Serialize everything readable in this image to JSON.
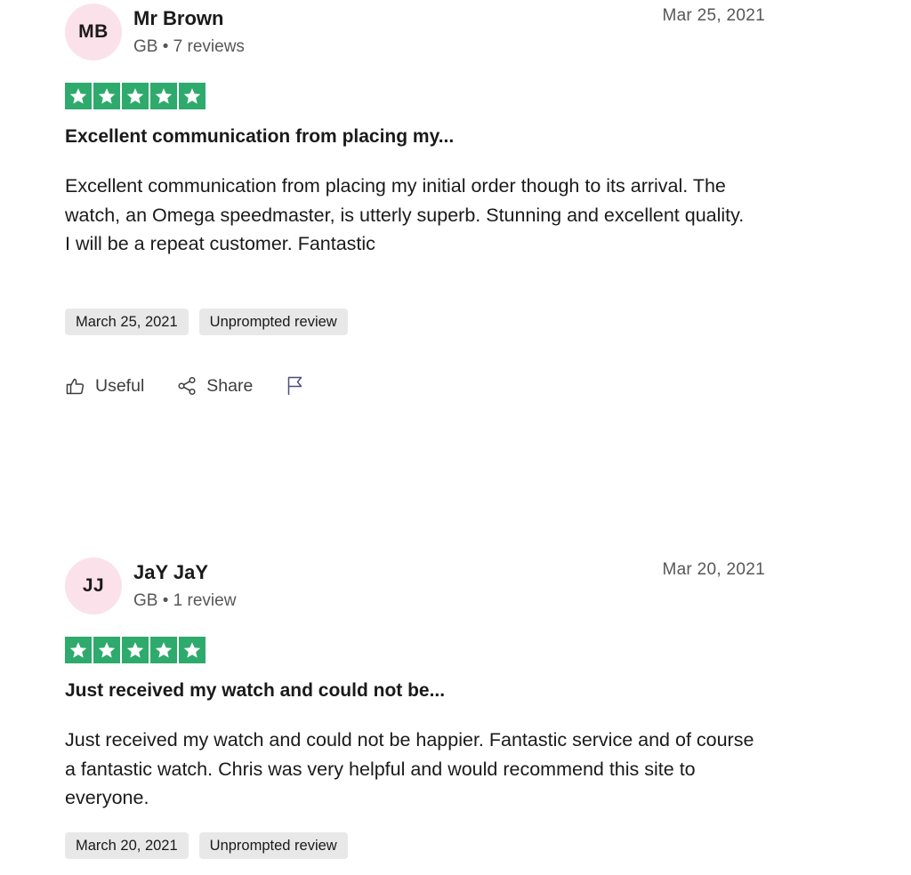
{
  "reviews": [
    {
      "avatar_initials": "MB",
      "name": "Mr Brown",
      "meta": "GB • 7 reviews",
      "date": "Mar 25, 2021",
      "rating": 5,
      "title": "Excellent communication from placing my...",
      "body": "Excellent communication from placing my initial order though to its arrival. The watch, an Omega speedmaster, is utterly superb. Stunning and excellent quality.\nI will be a repeat customer. Fantastic",
      "tags": [
        "March 25, 2021",
        "Unprompted review"
      ],
      "actions": {
        "useful": "Useful",
        "share": "Share"
      }
    },
    {
      "avatar_initials": "JJ",
      "name": "JaY JaY",
      "meta": "GB • 1 review",
      "date": "Mar 20, 2021",
      "rating": 5,
      "title": "Just received my watch and could not be...",
      "body": "Just received my watch and could not be happier. Fantastic service and of course a fantastic watch. Chris was very helpful and would recommend this site to everyone.",
      "tags": [
        "March 20, 2021",
        "Unprompted review"
      ]
    }
  ],
  "colors": {
    "star_background": "#2faa6d",
    "avatar_background": "#fbe1ea",
    "tag_background": "#e8e8e8"
  },
  "icons": {
    "star": "star-icon",
    "useful": "thumbs-up-icon",
    "share": "share-icon",
    "report": "flag-icon"
  }
}
